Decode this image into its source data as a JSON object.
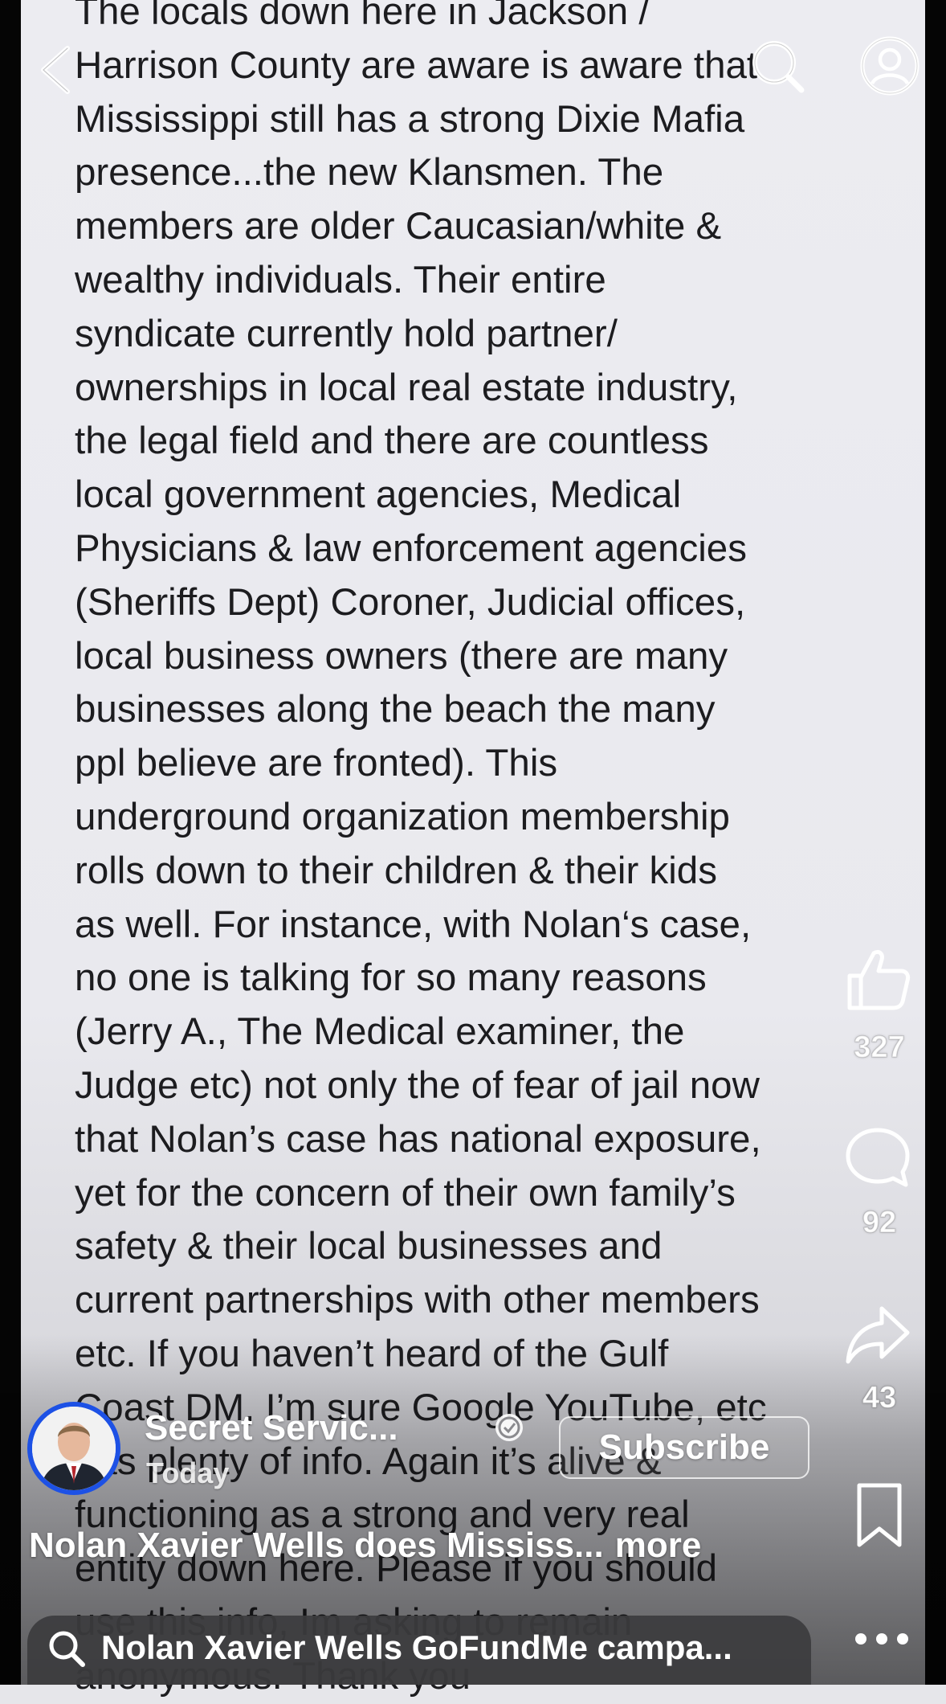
{
  "post_lines": [
    "The locals down here in Jackson /",
    "Harrison County are aware is aware that",
    "Mississippi still has a strong Dixie Mafia",
    "presence...the new Klansmen. The",
    "members are older Caucasian/white &",
    "wealthy individuals. Their entire",
    "syndicate currently hold partner/",
    "ownerships in local real estate industry,",
    "the legal field and there are countless",
    "local government agencies, Medical",
    "Physicians & law enforcement agencies",
    "(Sheriffs Dept) Coroner, Judicial offices,",
    "local business owners (there are many",
    "businesses along the beach the many",
    "ppl believe are fronted). This",
    "underground organization membership",
    "rolls down to their children & their kids",
    "as well. For instance, with Nolan‘s case,",
    "no one is talking for so many reasons",
    "(Jerry A., The Medical examiner, the",
    "Judge etc) not only the of fear of jail now",
    "that Nolan’s case has national exposure,",
    "yet for the concern of their own family’s",
    "safety & their local businesses and",
    "current partnerships with other members",
    "etc. If you haven’t heard of the Gulf",
    "Coast DM, I’m sure Google YouTube, etc",
    "has plenty of info. Again it’s alive &",
    "functioning as a strong and very real",
    "entity down here. Please if you should",
    "use this info, Im asking to remain",
    "anonymous. Thank you"
  ],
  "actions": {
    "like_count": "327",
    "comment_count": "92",
    "share_count": "43"
  },
  "channel": {
    "name": "Secret Servic...",
    "date": "Today",
    "subscribe_label": "Subscribe"
  },
  "caption": {
    "text": "Nolan Xavier Wells does Mississ...",
    "more_label": "more"
  },
  "search": {
    "query": "Nolan Xavier Wells GoFundMe campa..."
  },
  "icons": {
    "back": "chevron-left-icon",
    "lens": "lens-search-icon",
    "account": "account-icon",
    "like": "thumbs-up-icon",
    "comment": "comment-icon",
    "share": "share-icon",
    "verified": "verified-badge-icon",
    "save": "bookmark-icon",
    "search": "search-icon",
    "more": "more-dots-icon"
  },
  "colors": {
    "paper": "#e9e9ee",
    "text": "#1c1c1f",
    "avatar_ring": "#1d51e5"
  }
}
